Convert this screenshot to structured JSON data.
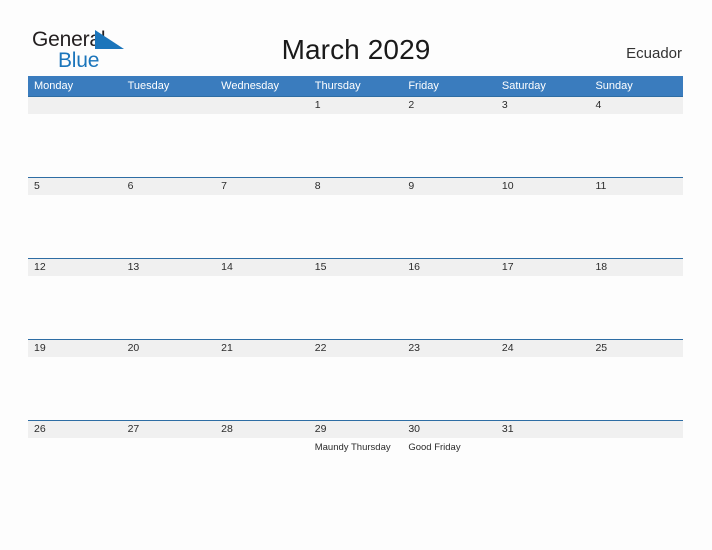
{
  "brand": {
    "name_part1": "General",
    "name_part2": "Blue",
    "mark": "blue-flag-triangle-icon"
  },
  "header": {
    "title": "March 2029",
    "region": "Ecuador"
  },
  "calendar": {
    "month": "March",
    "year": "2029",
    "weekdays": [
      "Monday",
      "Tuesday",
      "Wednesday",
      "Thursday",
      "Friday",
      "Saturday",
      "Sunday"
    ],
    "weeks": [
      [
        {
          "date": "",
          "event": ""
        },
        {
          "date": "",
          "event": ""
        },
        {
          "date": "",
          "event": ""
        },
        {
          "date": "1",
          "event": ""
        },
        {
          "date": "2",
          "event": ""
        },
        {
          "date": "3",
          "event": ""
        },
        {
          "date": "4",
          "event": ""
        }
      ],
      [
        {
          "date": "5",
          "event": ""
        },
        {
          "date": "6",
          "event": ""
        },
        {
          "date": "7",
          "event": ""
        },
        {
          "date": "8",
          "event": ""
        },
        {
          "date": "9",
          "event": ""
        },
        {
          "date": "10",
          "event": ""
        },
        {
          "date": "11",
          "event": ""
        }
      ],
      [
        {
          "date": "12",
          "event": ""
        },
        {
          "date": "13",
          "event": ""
        },
        {
          "date": "14",
          "event": ""
        },
        {
          "date": "15",
          "event": ""
        },
        {
          "date": "16",
          "event": ""
        },
        {
          "date": "17",
          "event": ""
        },
        {
          "date": "18",
          "event": ""
        }
      ],
      [
        {
          "date": "19",
          "event": ""
        },
        {
          "date": "20",
          "event": ""
        },
        {
          "date": "21",
          "event": ""
        },
        {
          "date": "22",
          "event": ""
        },
        {
          "date": "23",
          "event": ""
        },
        {
          "date": "24",
          "event": ""
        },
        {
          "date": "25",
          "event": ""
        }
      ],
      [
        {
          "date": "26",
          "event": ""
        },
        {
          "date": "27",
          "event": ""
        },
        {
          "date": "28",
          "event": ""
        },
        {
          "date": "29",
          "event": "Maundy Thursday"
        },
        {
          "date": "30",
          "event": "Good Friday"
        },
        {
          "date": "31",
          "event": ""
        },
        {
          "date": "",
          "event": ""
        }
      ]
    ]
  },
  "colors": {
    "header_blue": "#3a7cbe",
    "row_rule_blue": "#2e6da4",
    "date_band_gray": "#f0f0f0",
    "brand_blue": "#1b75bb",
    "page_background": "#fdfdfd",
    "text_dark": "#2b2b2b"
  }
}
